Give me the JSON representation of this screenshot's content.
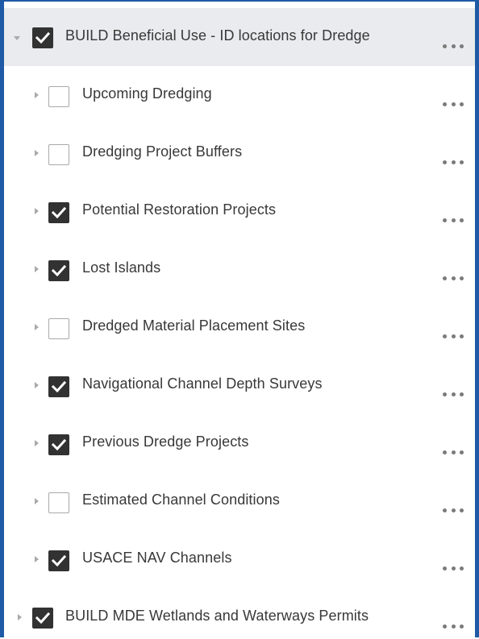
{
  "layers": [
    {
      "label": "BUILD Beneficial Use - ID locations for Dredge",
      "checked": true,
      "level": 0,
      "expanded": true
    },
    {
      "label": "Upcoming Dredging",
      "checked": false,
      "level": 1,
      "expanded": false
    },
    {
      "label": "Dredging Project Buffers",
      "checked": false,
      "level": 1,
      "expanded": false
    },
    {
      "label": "Potential Restoration Projects",
      "checked": true,
      "level": 1,
      "expanded": false
    },
    {
      "label": "Lost Islands",
      "checked": true,
      "level": 1,
      "expanded": false
    },
    {
      "label": "Dredged Material Placement Sites",
      "checked": false,
      "level": 1,
      "expanded": false
    },
    {
      "label": "Navigational Channel Depth Surveys",
      "checked": true,
      "level": 1,
      "expanded": false
    },
    {
      "label": "Previous Dredge Projects",
      "checked": true,
      "level": 1,
      "expanded": false
    },
    {
      "label": "Estimated Channel Conditions",
      "checked": false,
      "level": 1,
      "expanded": false
    },
    {
      "label": "USACE NAV Channels",
      "checked": true,
      "level": 1,
      "expanded": false
    },
    {
      "label": "BUILD MDE Wetlands and Waterways Permits",
      "checked": true,
      "level": 0,
      "expanded": false
    }
  ],
  "icons": {
    "expand": "caret-down-icon",
    "collapse": "caret-right-icon",
    "checked": "checkmark-icon",
    "options": "ellipsis-icon"
  },
  "colors": {
    "panel_border": "#1f5aa6",
    "selected_row_bg": "#e9ebee",
    "checkbox_on": "#323232",
    "checkbox_off_border": "#a9a9a9",
    "text": "#383838"
  }
}
